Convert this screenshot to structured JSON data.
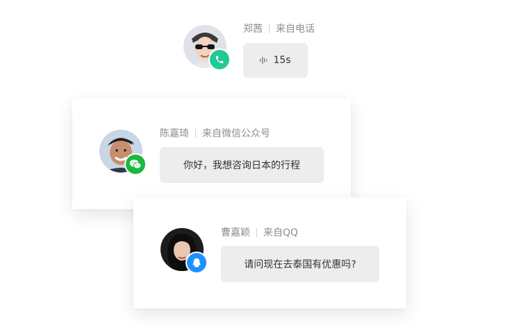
{
  "conversations": [
    {
      "name": "郑茜",
      "source": "来自电话",
      "message": "15s",
      "channel_icon": "phone-icon",
      "channel_color": "#20c997"
    },
    {
      "name": "陈嘉琦",
      "source": "来自微信公众号",
      "message": "你好，我想咨询日本的行程",
      "channel_icon": "wechat-icon",
      "channel_color": "#19b93b"
    },
    {
      "name": "曹嘉颖",
      "source": "来自QQ",
      "message": "请问现在去泰国有优惠吗?",
      "channel_icon": "qq-icon",
      "channel_color": "#1e90ff"
    }
  ]
}
